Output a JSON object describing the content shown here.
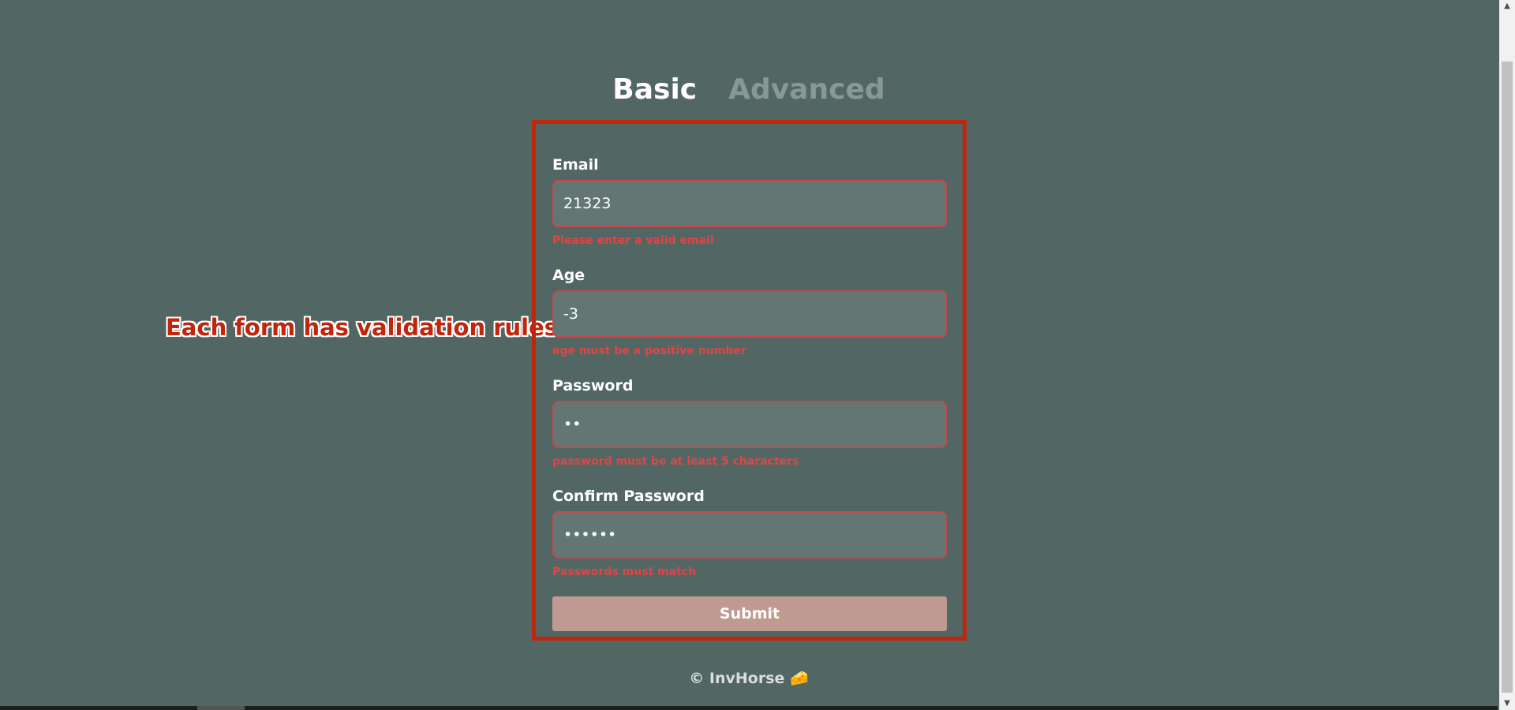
{
  "tabs": {
    "basic": "Basic",
    "advanced": "Advanced"
  },
  "annotation": "Each form has validation rules",
  "form": {
    "email": {
      "label": "Email",
      "value": "21323",
      "error": "Please enter a valid email"
    },
    "age": {
      "label": "Age",
      "value": "-3",
      "error": "age must be a positive number"
    },
    "password": {
      "label": "Password",
      "value": "••",
      "error": "password must be at least 5 characters"
    },
    "confirm_password": {
      "label": "Confirm Password",
      "value": "••••••",
      "error": "Passwords must match"
    },
    "submit_label": "Submit"
  },
  "footer": "© InvHorse 🧀",
  "colors": {
    "background": "#526763",
    "accent_red": "#c0250d",
    "error_text": "#e24447",
    "submit_bg": "#bf9a90"
  }
}
